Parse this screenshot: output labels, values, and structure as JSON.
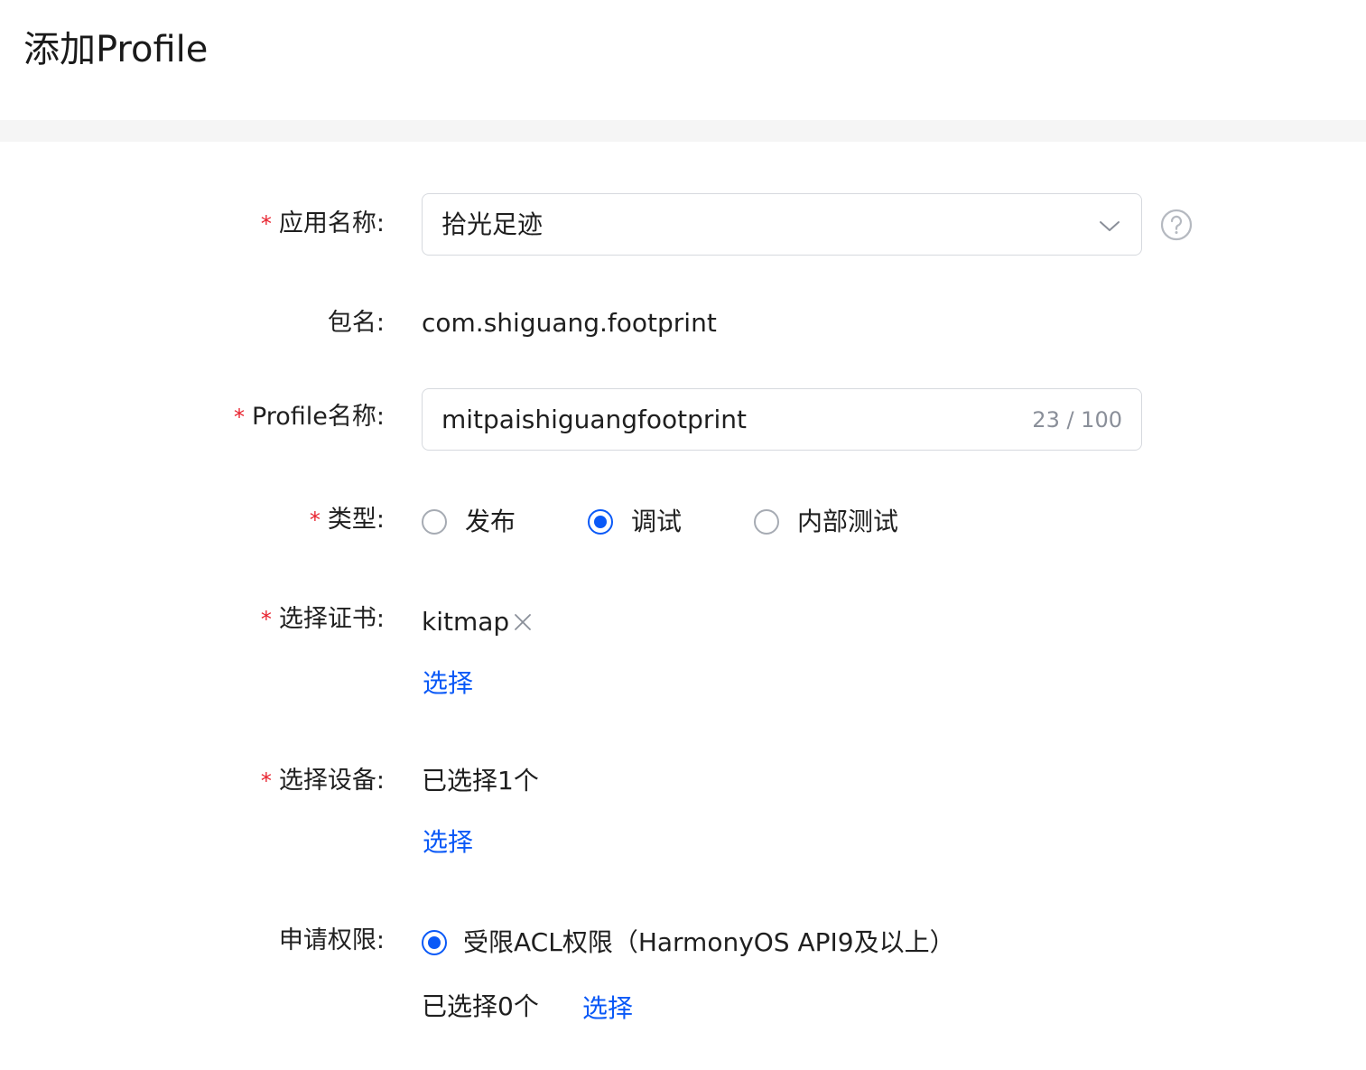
{
  "header": {
    "title": "添加Profile"
  },
  "form": {
    "app_name": {
      "label": "应用名称:",
      "required_mark": "*",
      "value": "拾光足迹"
    },
    "package_name": {
      "label": "包名:",
      "value": "com.shiguang.footprint"
    },
    "profile_name": {
      "label": "Profile名称:",
      "required_mark": "*",
      "value": "mitpaishiguangfootprint",
      "counter": "23 / 100"
    },
    "type": {
      "label": "类型:",
      "required_mark": "*",
      "options": [
        {
          "label": "发布",
          "checked": false
        },
        {
          "label": "调试",
          "checked": true
        },
        {
          "label": "内部测试",
          "checked": false
        }
      ]
    },
    "certificate": {
      "label": "选择证书:",
      "required_mark": "*",
      "selected_tag": "kitmap",
      "select_link": "选择"
    },
    "device": {
      "label": "选择设备:",
      "required_mark": "*",
      "summary": "已选择1个",
      "select_link": "选择"
    },
    "permission": {
      "label": "申请权限:",
      "option_label": "受限ACL权限（HarmonyOS API9及以上）",
      "checked": true,
      "summary": "已选择0个",
      "select_link": "选择"
    }
  },
  "colors": {
    "accent": "#0a59f7",
    "required": "#e8222e",
    "divider": "#f5f5f5",
    "border": "#d6d9de",
    "muted": "#8a8f99"
  },
  "icons": {
    "app_select": "chevron-down-icon",
    "help": "question-circle-icon",
    "tag_remove": "close-icon"
  }
}
